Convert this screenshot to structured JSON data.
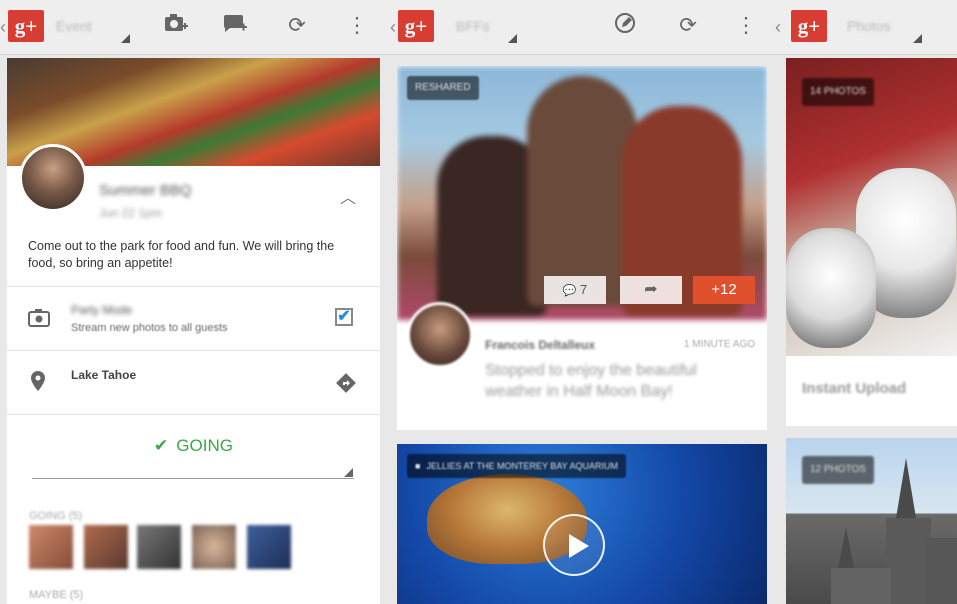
{
  "panels": {
    "event": {
      "nav_title": "Event",
      "event_title": "Summer BBQ",
      "event_date": "Jun 22 1pm",
      "description": "Come out to the park for food and fun.  We will bring the food, so bring an appetite!",
      "party_mode_title": "Party Mode",
      "party_mode_subtitle": "Stream new photos to all guests",
      "party_mode_checked": "✔",
      "location": "Lake Tahoe",
      "rsvp_label": "GOING",
      "rsvp_check": "✔",
      "going_header": "GOING (5)",
      "maybe_header": "MAYBE (5)"
    },
    "bffs": {
      "nav_title": "BFFs",
      "post_badge": "RESHARED",
      "comment_count": "7",
      "plus_count": "+12",
      "author": "Francois Deltalleux",
      "timestamp": "1 MINUTE AGO",
      "post_text": "Stopped to enjoy the beautiful weather in Half Moon Bay!",
      "video_caption": "JELLIES AT THE MONTEREY BAY AQUARIUM"
    },
    "photos": {
      "nav_title": "Photos",
      "album1_count": "14 PHOTOS",
      "album1_title": "Instant Upload",
      "album2_count": "12 PHOTOS"
    }
  },
  "icons": {
    "back": "‹",
    "gplus": "g+",
    "overflow": "⋮",
    "refresh": "⟳",
    "share": "➦",
    "comment": "💬"
  },
  "colors": {
    "gplus_red": "#d73d32",
    "going_green": "#3aa84a",
    "plus_badge": "#e0502d",
    "checkbox_blue": "#2a8cd8"
  }
}
